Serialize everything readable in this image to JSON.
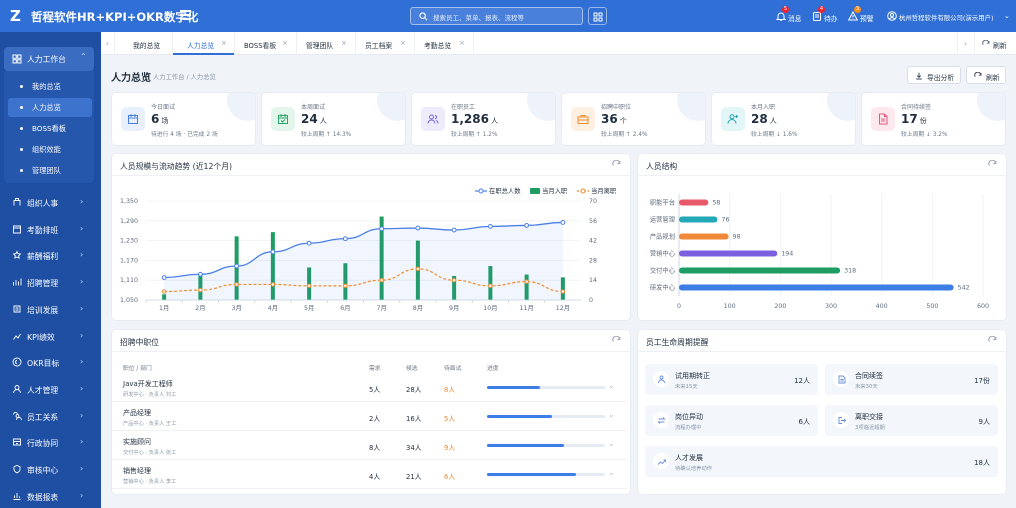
{
  "app": {
    "logo_letter": "Z",
    "title": "哲程软件HR+KPI+OKR数字化"
  },
  "search": {
    "placeholder": "搜索员工、菜单、报表、流程等"
  },
  "top_actions": [
    {
      "label": "消息",
      "badge": "5"
    },
    {
      "label": "待办",
      "badge": "4"
    },
    {
      "label": "预警",
      "badge": "3"
    }
  ],
  "user": {
    "company": "杭州哲程软件有限公司(演示用户)"
  },
  "sidebar": {
    "active_group": "人力工作台",
    "sub_items": [
      "我的总览",
      "人力总览",
      "BOSS看板",
      "组织效能",
      "管理团队"
    ],
    "active_sub": "人力总览",
    "groups": [
      "组织人事",
      "考勤排班",
      "薪酬福利",
      "招聘管理",
      "培训发展",
      "KPI绩效",
      "OKR目标",
      "人才管理",
      "员工关系",
      "行政协同",
      "审核中心",
      "数据报表"
    ]
  },
  "tabs": [
    {
      "label": "我的总览",
      "closable": false
    },
    {
      "label": "人力总览",
      "closable": true,
      "active": true
    },
    {
      "label": "BOSS看板",
      "closable": true
    },
    {
      "label": "管理团队",
      "closable": true
    },
    {
      "label": "员工档案",
      "closable": true
    },
    {
      "label": "考勤总览",
      "closable": true
    }
  ],
  "tab_refresh": "刷新",
  "page": {
    "title": "人力总览",
    "breadcrumb": "人力工作台 / 人力总览",
    "export_label": "导出分析",
    "refresh_label": "刷新"
  },
  "kpis": [
    {
      "title": "今日面试",
      "value": "6",
      "unit": "场",
      "sub": "待进行 4 场 · 已完成 2 场",
      "color": "#4a7fe0",
      "bg": "#e8f0fd",
      "icon": "calendar-icon"
    },
    {
      "title": "本周面试",
      "value": "24",
      "unit": "人",
      "sub": "较上周期 ↑ 14.3%",
      "color": "#2aa56d",
      "bg": "#e4f6ec",
      "icon": "calendar-check-icon"
    },
    {
      "title": "在职员工",
      "value": "1,286",
      "unit": "人",
      "sub": "较上周期 ↑ 1.2%",
      "color": "#7c6ae0",
      "bg": "#eeebfc",
      "icon": "users-icon"
    },
    {
      "title": "招聘中职位",
      "value": "36",
      "unit": "个",
      "sub": "较上周期 ↑ 2.4%",
      "color": "#f08a2a",
      "bg": "#fdf0e2",
      "icon": "briefcase-icon"
    },
    {
      "title": "本月入职",
      "value": "28",
      "unit": "人",
      "sub": "较上周期 ↓ 1.6%",
      "color": "#25a6b8",
      "bg": "#e2f5f7",
      "icon": "user-add-icon"
    },
    {
      "title": "合同待续签",
      "value": "17",
      "unit": "份",
      "sub": "较上周期 ↓ 3.2%",
      "color": "#e05a7a",
      "bg": "#fde8ee",
      "icon": "document-icon"
    }
  ],
  "trend_panel": {
    "title": "人员规模与流动趋势 (近12个月)"
  },
  "structure_panel": {
    "title": "人员结构"
  },
  "recruit_panel": {
    "title": "招聘中职位",
    "headers": [
      "职位 / 部门",
      "需求",
      "候选",
      "待面试",
      "进度"
    ],
    "rows": [
      {
        "name": "Java开发工程师",
        "dept": "研发中心 · 负责人 刘工",
        "need": "5人",
        "cand": "28人",
        "pending": "8人",
        "progress": 0.45
      },
      {
        "name": "产品经理",
        "dept": "产品中心 · 负责人 王工",
        "need": "2人",
        "cand": "16人",
        "pending": "5人",
        "progress": 0.55
      },
      {
        "name": "实施顾问",
        "dept": "交付中心 · 负责人 张工",
        "need": "8人",
        "cand": "34人",
        "pending": "9人",
        "progress": 0.65
      },
      {
        "name": "销售经理",
        "dept": "营销中心 · 负责人 李工",
        "need": "4人",
        "cand": "21人",
        "pending": "6人",
        "progress": 0.75
      }
    ]
  },
  "lifecycle_panel": {
    "title": "员工生命周期提醒",
    "items": [
      {
        "title": "试用期转正",
        "sub": "未来15天",
        "value": "12人",
        "icon": "person-icon"
      },
      {
        "title": "合同续签",
        "sub": "未来30天",
        "value": "17份",
        "icon": "document-icon"
      },
      {
        "title": "岗位异动",
        "sub": "流程办理中",
        "value": "6人",
        "icon": "swap-icon"
      },
      {
        "title": "离职交接",
        "sub": "3项临近超期",
        "value": "9人",
        "icon": "exit-icon"
      },
      {
        "title": "人才发展",
        "sub": "待确认培养动作",
        "value": "18人",
        "icon": "growth-icon"
      }
    ]
  },
  "chart_data": [
    {
      "type": "line",
      "categories": [
        "1月",
        "2月",
        "3月",
        "4月",
        "5月",
        "6月",
        "7月",
        "8月",
        "9月",
        "10月",
        "11月",
        "12月"
      ],
      "series": [
        {
          "name": "在职总人数",
          "type": "line",
          "axis": "left",
          "color": "#4a80e6",
          "values": [
            1118,
            1128,
            1153,
            1196,
            1222,
            1236,
            1266,
            1268,
            1262,
            1273,
            1276,
            1285
          ]
        },
        {
          "name": "当月入职",
          "type": "bar",
          "axis": "right",
          "color": "#1e9d62",
          "values": [
            4,
            19,
            45,
            48,
            23,
            26,
            59,
            42,
            17,
            24,
            18,
            16
          ]
        },
        {
          "name": "当月离职",
          "type": "line",
          "axis": "right",
          "color": "#f08a2a",
          "values": [
            6,
            7,
            11,
            11,
            10,
            10,
            14,
            22,
            14,
            10,
            13,
            6
          ]
        }
      ],
      "y_left": {
        "ticks": [
          1050,
          1110,
          1170,
          1230,
          1290,
          1350
        ],
        "ylim": [
          1050,
          1350
        ]
      },
      "y_right": {
        "ticks": [
          0,
          14,
          28,
          42,
          56,
          70
        ],
        "ylim": [
          0,
          70
        ]
      },
      "grid": true,
      "legend": "top-right"
    },
    {
      "type": "bar",
      "orientation": "horizontal",
      "categories": [
        "职能平台",
        "运营管理",
        "产品规划",
        "营销中心",
        "交付中心",
        "研发中心"
      ],
      "values": [
        58,
        76,
        98,
        194,
        318,
        542
      ],
      "colors": [
        "#e85a6a",
        "#22a8b6",
        "#f08a3a",
        "#7a60e0",
        "#1e9d62",
        "#3c7ee6"
      ],
      "x_ticks": [
        0,
        100,
        200,
        300,
        400,
        500,
        600
      ],
      "xlim": [
        0,
        600
      ],
      "grid": true
    }
  ]
}
